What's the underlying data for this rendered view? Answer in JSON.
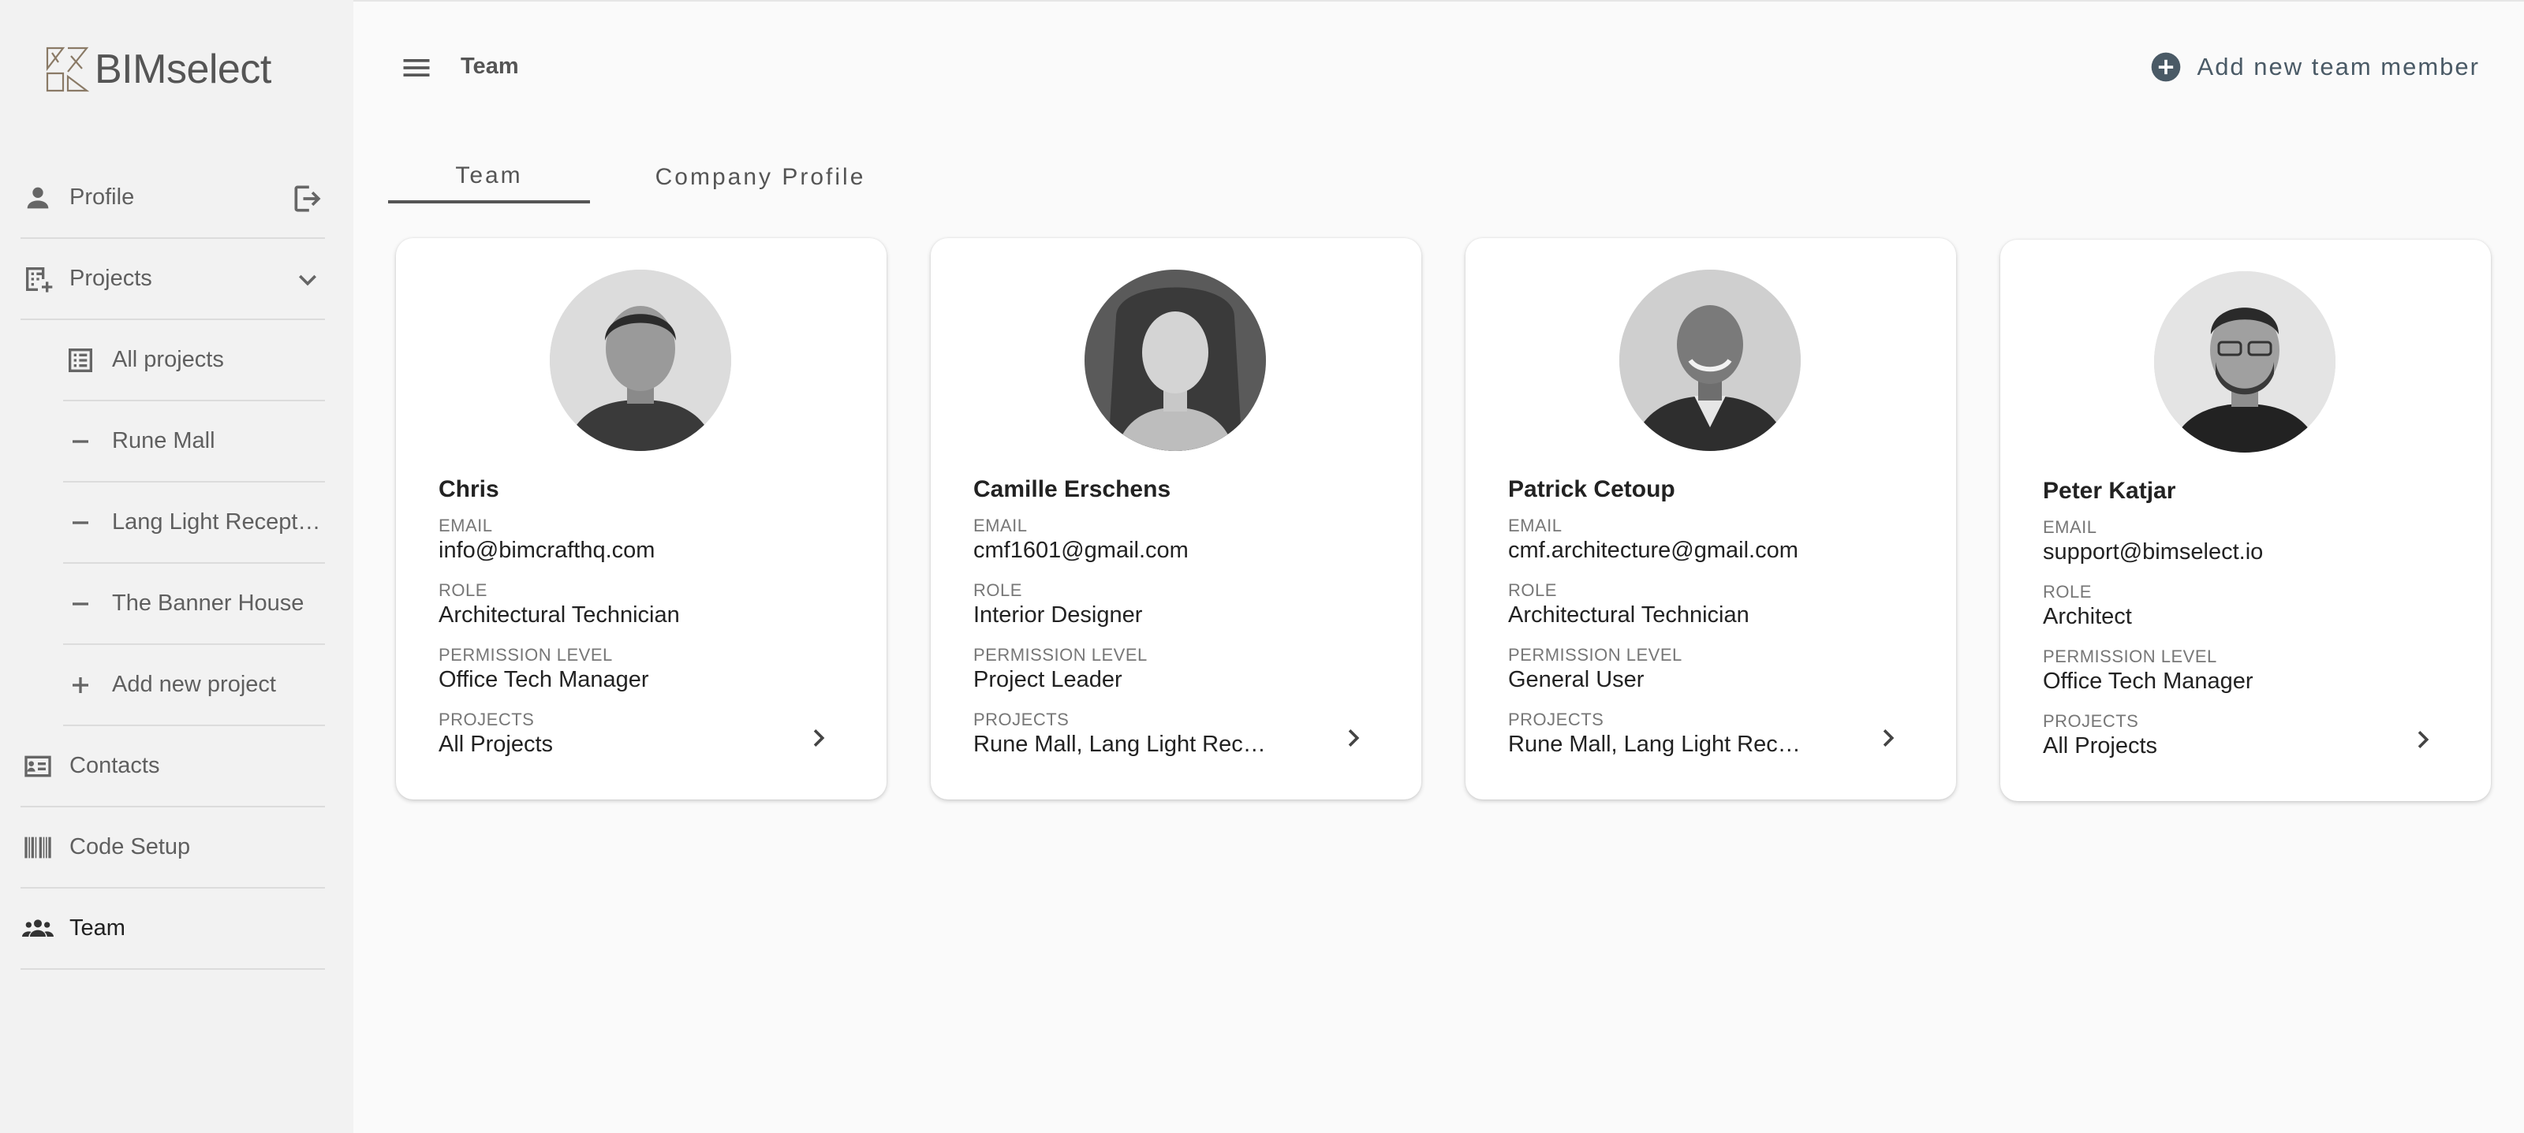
{
  "app": {
    "logo_text": "BIMselect"
  },
  "sidebar": {
    "items": [
      {
        "label": "Profile",
        "icon": "person-icon"
      },
      {
        "label": "Projects",
        "icon": "projects-add-icon"
      },
      {
        "label": "Contacts",
        "icon": "contact-card-icon"
      },
      {
        "label": "Code Setup",
        "icon": "barcode-icon"
      },
      {
        "label": "Team",
        "icon": "team-icon",
        "active": true
      }
    ],
    "projects_sub": [
      {
        "label": "All projects",
        "icon": "list-icon"
      },
      {
        "label": "Rune Mall",
        "icon": "minus-icon"
      },
      {
        "label": "Lang Light Recept…",
        "icon": "minus-icon"
      },
      {
        "label": "The Banner House",
        "icon": "minus-icon"
      },
      {
        "label": "Add new project",
        "icon": "plus-icon"
      }
    ]
  },
  "header": {
    "title": "Team",
    "add_member_label": "Add new team member"
  },
  "tabs": [
    {
      "label": "Team",
      "selected": true
    },
    {
      "label": "Company Profile",
      "selected": false
    }
  ],
  "labels": {
    "email": "EMAIL",
    "role": "ROLE",
    "permission": "PERMISSION LEVEL",
    "projects": "PROJECTS"
  },
  "members": [
    {
      "name": "Chris",
      "email": "info@bimcrafthq.com",
      "role": "Architectural Technician",
      "permission": "Office Tech Manager",
      "projects": "All Projects"
    },
    {
      "name": "Camille Erschens",
      "email": "cmf1601@gmail.com",
      "role": "Interior Designer",
      "permission": "Project Leader",
      "projects": "Rune Mall, Lang Light Rec…"
    },
    {
      "name": "Patrick Cetoup",
      "email": "cmf.architecture@gmail.com",
      "role": "Architectural Technician",
      "permission": "General User",
      "projects": "Rune Mall, Lang Light Rec…"
    },
    {
      "name": "Peter Katjar",
      "email": "support@bimselect.io",
      "role": "Architect",
      "permission": "Office Tech Manager",
      "projects": "All Projects"
    }
  ],
  "colors": {
    "accent": "#4a5a66",
    "sidebar_bg": "#f2f2f2",
    "page_bg": "#fafafa"
  }
}
